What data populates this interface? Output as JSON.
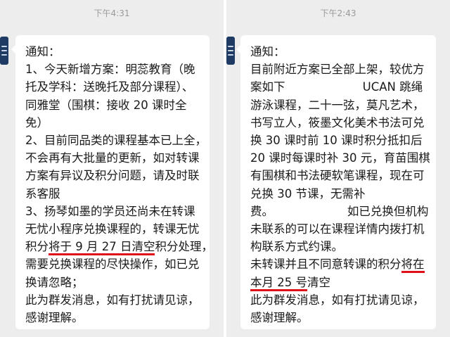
{
  "colors": {
    "underline": "#e0101a",
    "bubble": "#ffffff",
    "background": "#ededed",
    "timestamp": "#9a9a9a",
    "avatar": "#1f3a63"
  },
  "left": {
    "time": "下午4:31",
    "avatar_icon": "group-avatar-icon",
    "lines": [
      "通知：",
      "1、今天新增方案：明蕊教育（晚",
      "托及学科：送晚托及部分课程）、",
      "同雅堂（围棋：接收 20 课时全",
      "免）",
      "2、目前同品类的课程基本已上全，",
      "不会再有大批量的更新，如对转课",
      "方案有异议及积分问题，请及时联",
      "系客服",
      "3、扬琴如墨的学员还尚未在转课",
      "无忧小程序兑换课程的，转课无忧"
    ],
    "hl_pre": "积分",
    "hl_mark": "将于 9 月 27 日清空",
    "hl_post": "积分处理，",
    "lines_after": [
      "需要兑换课程的尽快操作，如已兑",
      "换请忽略；",
      "此为群发消息，如有打扰请见谅，",
      "感谢理解。"
    ]
  },
  "right": {
    "time": "下午2:43",
    "avatar_icon": "group-avatar-icon",
    "lines": [
      "通知：",
      "目前附近方案已全部上架，较优方",
      "案如下                     UCAN 跳绳",
      "游泳课程，二十一弦，莫凡艺术，",
      "书写立人，筱墨文化美术书法可兑",
      "换 30 课时前 10 课时积分抵扣后",
      "20 课时每课时补 30 元，育苗围棋",
      "有围棋和书法硬软笔课程，现在可",
      "兑换 30 节课，无需补",
      "费。                    如已兑换但机构",
      "未联系的可以在课程详情内拨打机",
      "构联系方式约课。"
    ],
    "hl1_pre": "未转课并且不同意转课的积分",
    "hl1_mark": "将在",
    "hl2_mark": "本月 25 号",
    "hl2_post": "清空",
    "lines_after": [
      "此为群发消息，如有打扰请见谅，",
      "感谢理解。"
    ]
  }
}
